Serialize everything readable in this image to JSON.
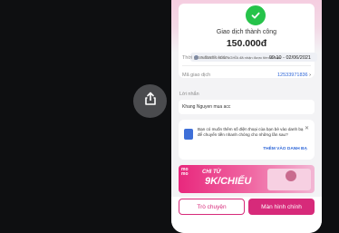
{
  "transaction": {
    "status_title": "Giao dịch thành công",
    "amount": "150.000đ",
    "notice": "NGUYỄN HỮU NGHĨA đã nhận được tiền từ bạn",
    "time_label": "Thời gian thanh toán",
    "time_value": "09:10 - 02/06/2021",
    "id_label": "Mã giao dịch",
    "id_value": "12533971836",
    "chevron": "›"
  },
  "message": {
    "label": "Lời nhắn",
    "text": "Khang Nguyen mua acc"
  },
  "suggestion": {
    "text": "Bạn có muốn thêm số điện thoại của bạn bè vào danh bạ để chuyển tiền nhanh chóng cho những lần sau?",
    "close": "✕",
    "action": "THÊM VÀO DANH BẠ"
  },
  "banner": {
    "brand_line1": "mo",
    "brand_line2": "mo",
    "promo_line1": "CHI TỪ",
    "promo_line2": "9K/CHIẾU"
  },
  "actions": {
    "chat": "Trò chuyện",
    "home": "Màn hình chính"
  },
  "colors": {
    "accent": "#d72a7a",
    "success": "#26c34a",
    "link": "#2f67d8"
  },
  "icons": {
    "share": "share-icon",
    "check": "check-icon",
    "info": "info-icon",
    "contact": "contact-book-icon"
  }
}
